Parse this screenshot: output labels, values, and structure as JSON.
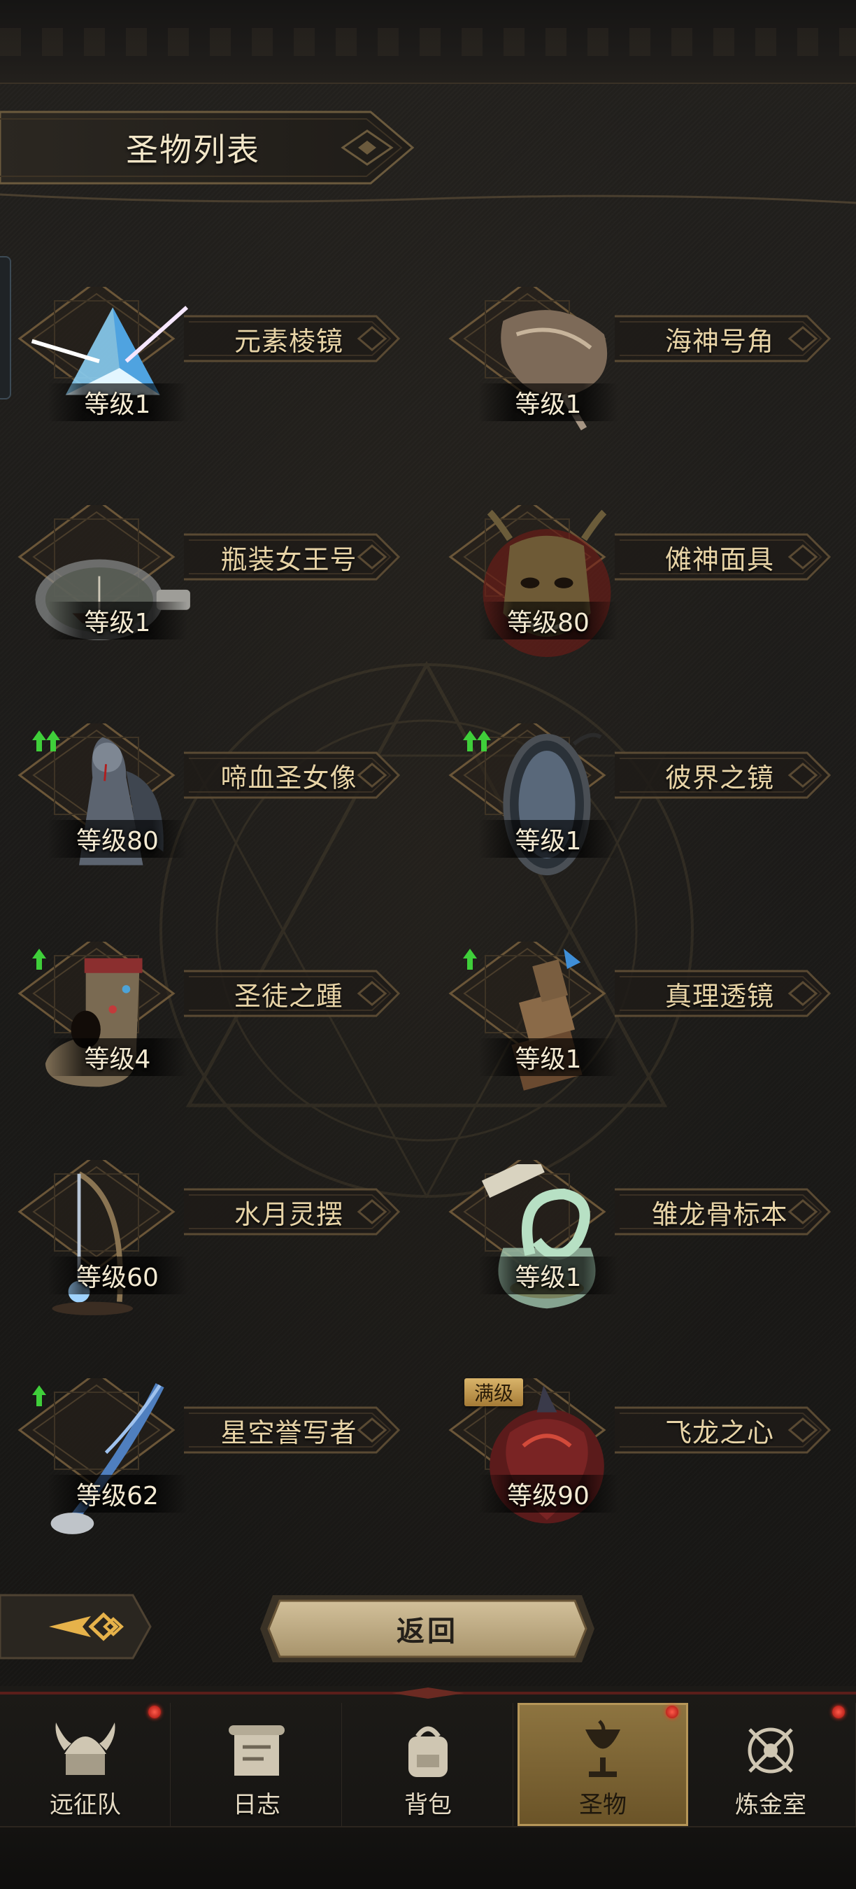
{
  "header": {
    "title": "圣物列表"
  },
  "relics": [
    {
      "name": "元素棱镜",
      "level": "等级1",
      "icon": "prism-icon",
      "upgrade": 0,
      "max": ""
    },
    {
      "name": "海神号角",
      "level": "等级1",
      "icon": "conch-horn-icon",
      "upgrade": 0,
      "max": ""
    },
    {
      "name": "瓶装女王号",
      "level": "等级1",
      "icon": "ship-in-bottle-icon",
      "upgrade": 0,
      "max": ""
    },
    {
      "name": "傩神面具",
      "level": "等级80",
      "icon": "demon-mask-icon",
      "upgrade": 0,
      "max": ""
    },
    {
      "name": "啼血圣女像",
      "level": "等级80",
      "icon": "weeping-statue-icon",
      "upgrade": 2,
      "max": ""
    },
    {
      "name": "彼界之镜",
      "level": "等级1",
      "icon": "mirror-icon",
      "upgrade": 2,
      "max": ""
    },
    {
      "name": "圣徒之踵",
      "level": "等级4",
      "icon": "saint-foot-icon",
      "upgrade": 1,
      "max": ""
    },
    {
      "name": "真理透镜",
      "level": "等级1",
      "icon": "telescope-icon",
      "upgrade": 1,
      "max": ""
    },
    {
      "name": "水月灵摆",
      "level": "等级60",
      "icon": "pendulum-icon",
      "upgrade": 0,
      "max": ""
    },
    {
      "name": "雏龙骨标本",
      "level": "等级1",
      "icon": "specimen-jar-icon",
      "upgrade": 0,
      "max": ""
    },
    {
      "name": "星空誉写者",
      "level": "等级62",
      "icon": "quill-icon",
      "upgrade": 1,
      "max": ""
    },
    {
      "name": "飞龙之心",
      "level": "等级90",
      "icon": "dragon-heart-icon",
      "upgrade": 0,
      "max": "满级"
    }
  ],
  "back_button": {
    "label": "返回"
  },
  "nav": [
    {
      "label": "远征队",
      "icon": "viking-helmet-icon",
      "active": false,
      "badge": true
    },
    {
      "label": "日志",
      "icon": "scroll-icon",
      "active": false,
      "badge": false
    },
    {
      "label": "背包",
      "icon": "backpack-icon",
      "active": false,
      "badge": false
    },
    {
      "label": "圣物",
      "icon": "chalice-icon",
      "active": true,
      "badge": true
    },
    {
      "label": "炼金室",
      "icon": "alchemy-icon",
      "active": false,
      "badge": true
    }
  ],
  "colors": {
    "gold": "#c9a968",
    "frame": "#5a4a33",
    "active_tab": "#8d7440",
    "badge": "#e0281c"
  }
}
